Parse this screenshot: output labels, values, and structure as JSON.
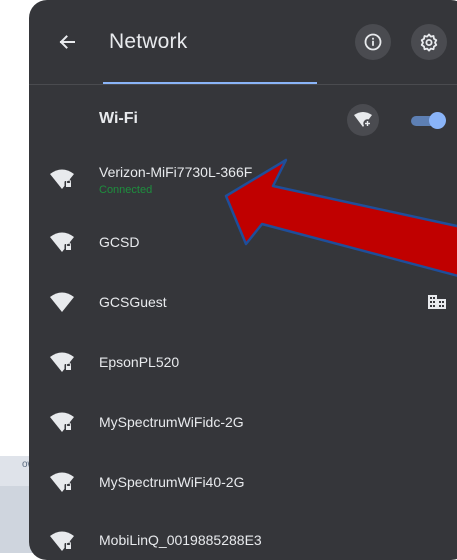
{
  "background": {
    "partial_text": "ow"
  },
  "header": {
    "title": "Network",
    "back_icon": "arrow-left-icon",
    "info_icon": "info-icon",
    "settings_icon": "gear-icon"
  },
  "wifi_section": {
    "label": "Wi-Fi",
    "add_network_icon": "wifi-add-icon",
    "toggle_on": true
  },
  "networks": [
    {
      "name": "Verizon-MiFi7730L-366F",
      "status": "Connected",
      "secured": true
    },
    {
      "name": "GCSD",
      "secured": true
    },
    {
      "name": "GCSGuest",
      "secured": false,
      "managed_icon": "building-icon"
    },
    {
      "name": "EpsonPL520",
      "secured": true
    },
    {
      "name": "MySpectrumWiFidc-2G",
      "secured": true
    },
    {
      "name": "MySpectrumWiFi40-2G",
      "secured": true
    },
    {
      "name": "MobiLinQ_0019885288E3",
      "secured": true
    }
  ],
  "colors": {
    "panel": "#35363a",
    "text": "#e8eaed",
    "accent": "#8ab4f8",
    "connected": "#1e8e3e",
    "annotation_arrow": "#c00000"
  }
}
